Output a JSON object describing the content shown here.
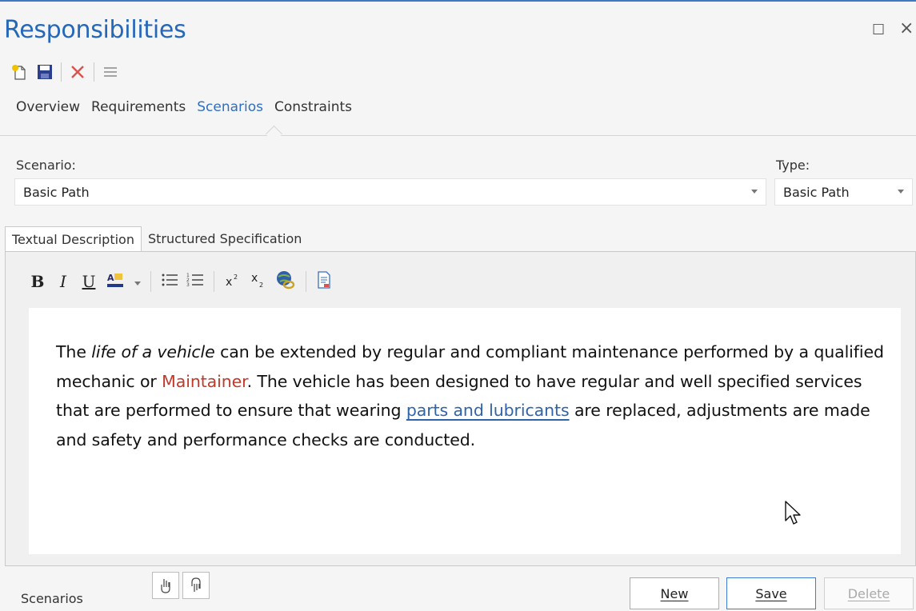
{
  "window": {
    "title": "Responsibilities",
    "restore_glyph": "☐",
    "close_glyph": "×"
  },
  "toolbar": {
    "icons": [
      "new-icon",
      "save-icon",
      "delete-icon",
      "menu-icon"
    ]
  },
  "nav_tabs": [
    {
      "label": "Overview",
      "active": false
    },
    {
      "label": "Requirements",
      "active": false
    },
    {
      "label": "Scenarios",
      "active": true
    },
    {
      "label": "Constraints",
      "active": false
    }
  ],
  "scenario": {
    "label": "Scenario:",
    "value": "Basic Path"
  },
  "type": {
    "label": "Type:",
    "value": "Basic Path"
  },
  "subtabs": [
    {
      "label": "Textual Description",
      "active": true
    },
    {
      "label": "Structured Specification",
      "active": false
    }
  ],
  "format_bar": {
    "bold": "B",
    "italic": "I",
    "underline": "U"
  },
  "description": {
    "p1": "The ",
    "italic_term": "life of a vehicle",
    "p2": " can be extended by regular and compliant maintenance performed by a qualified mechanic or ",
    "red_term": "Maintainer",
    "p3": ". The vehicle has been designed to have regular and well specified services that are performed to ensure that wearing ",
    "link_term": "parts and lubricants",
    "p4": " are replaced, adjustments are made and safety and performance checks are conducted."
  },
  "bottom": {
    "scenarios_label": "Scenarios",
    "new_label": "New",
    "save_label": "Save",
    "delete_label": "Delete"
  },
  "colors": {
    "accent": "#2667b8",
    "red_term": "#c0392b",
    "link_term": "#2f64a8"
  }
}
